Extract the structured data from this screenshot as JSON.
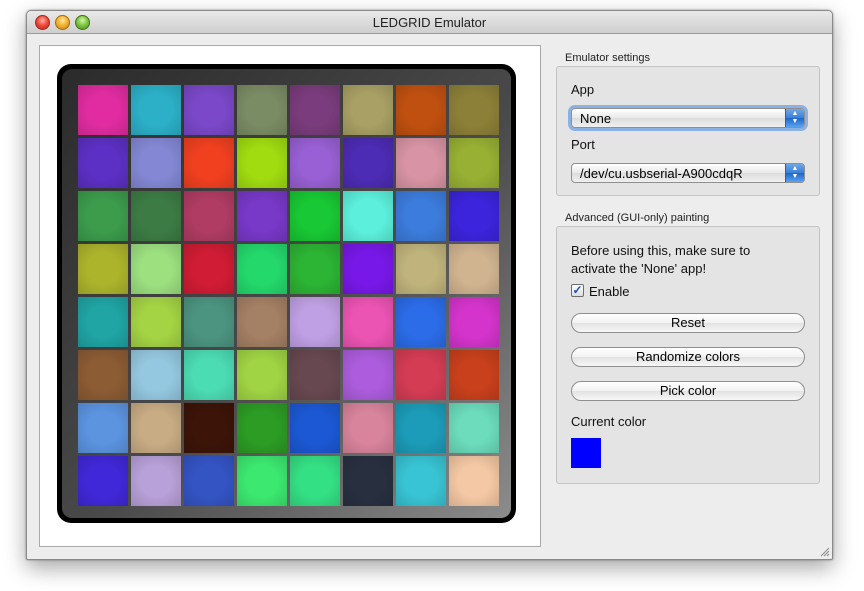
{
  "window": {
    "title": "LEDGRID Emulator"
  },
  "grid": {
    "colors": [
      [
        "#e02ca0",
        "#2cb0c8",
        "#7a48c8",
        "#7a8c64",
        "#7a3c7c",
        "#a8a064",
        "#c05010",
        "#8c8038"
      ],
      [
        "#5c30c4",
        "#8488d4",
        "#f04020",
        "#a0dc10",
        "#9860d4",
        "#4c2cb4",
        "#d894a4",
        "#98b034"
      ],
      [
        "#3c9c4c",
        "#3c7c44",
        "#b03c64",
        "#7838c8",
        "#18c834",
        "#5cf0dc",
        "#3c7cdc",
        "#3c24dc"
      ],
      [
        "#acb42c",
        "#9ce080",
        "#d01c34",
        "#24d86c",
        "#2cb434",
        "#7818e8",
        "#c0b47c",
        "#d0b490"
      ],
      [
        "#20a4a4",
        "#a4d444",
        "#4c9480",
        "#a48064",
        "#c0a0e4",
        "#ec54b4",
        "#2c6ce8",
        "#d434cc"
      ],
      [
        "#8c5c34",
        "#94c8e0",
        "#4cdcb4",
        "#a0d444",
        "#684850",
        "#ac5cdc",
        "#d43c54",
        "#c8401c"
      ],
      [
        "#5c94e0",
        "#c8ac84",
        "#3c1408",
        "#2c9c24",
        "#1c58d4",
        "#d8849c",
        "#1c9cb8",
        "#6cdcbc"
      ],
      [
        "#4028d8",
        "#b8a0d8",
        "#3454c4",
        "#3ce870",
        "#34e084",
        "#283040",
        "#38c4d4",
        "#f4c8a4"
      ]
    ]
  },
  "settings": {
    "group_title": "Emulator settings",
    "app_label": "App",
    "app_value": "None",
    "port_label": "Port",
    "port_value": "/dev/cu.usbserial-A900cdqR"
  },
  "painting": {
    "group_title": "Advanced (GUI-only) painting",
    "note_line1": "Before using this, make sure to",
    "note_line2": "activate the 'None' app!",
    "enable_label": "Enable",
    "enable_checked": true,
    "reset_label": "Reset",
    "randomize_label": "Randomize colors",
    "pick_label": "Pick color",
    "current_color_label": "Current color",
    "current_color": "#0000ff"
  }
}
